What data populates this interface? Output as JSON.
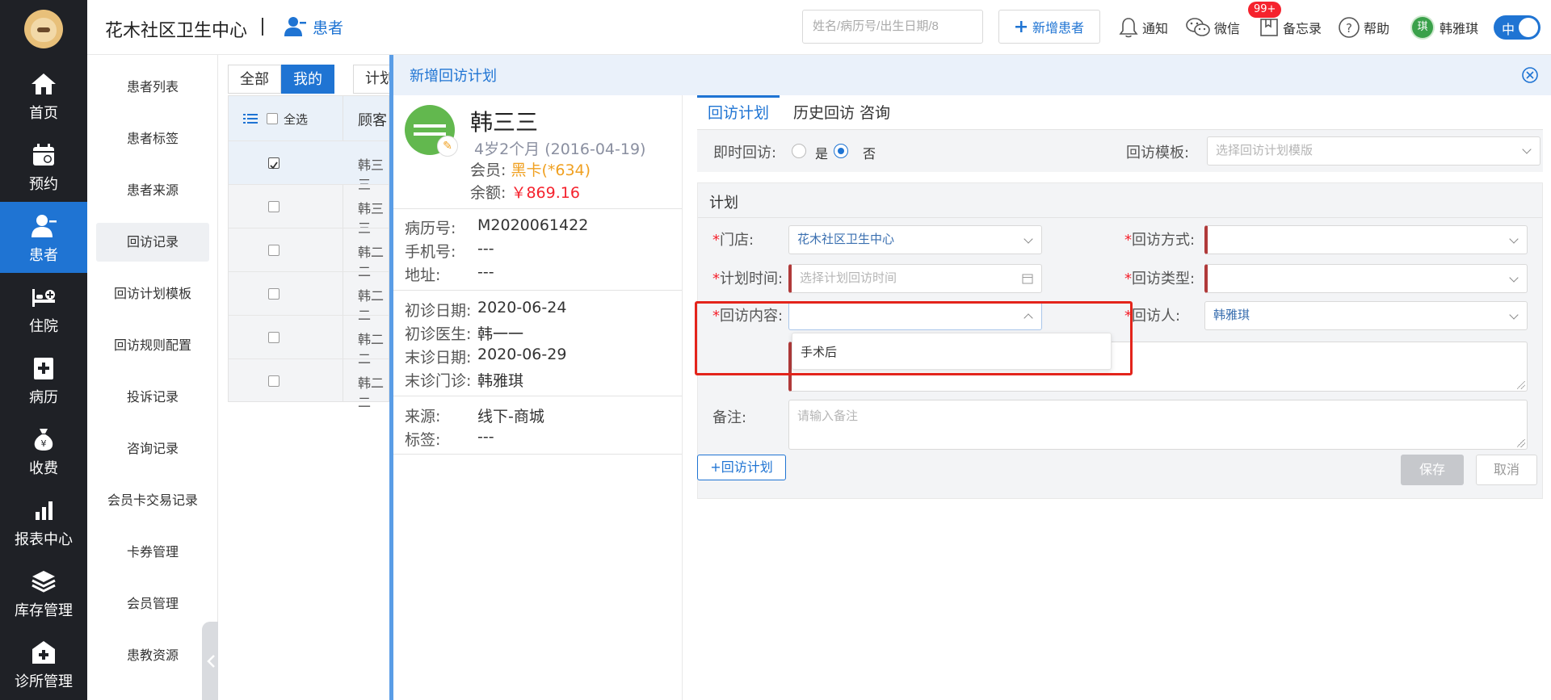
{
  "header": {
    "clinic_name": "花木社区卫生中心",
    "section_label": "患者",
    "search_placeholder": "姓名/病历号/出生日期/8",
    "new_patient_label": "新增患者",
    "notify_label": "通知",
    "notify_badge": "99+",
    "wechat_label": "微信",
    "memo_label": "备忘录",
    "help_label": "帮助",
    "user_avatar_text": "琪",
    "user_name": "韩雅琪",
    "toggle_label": "中"
  },
  "leftnav": {
    "items": [
      {
        "label": "首页",
        "icon": "home-icon"
      },
      {
        "label": "预约",
        "icon": "calendar-icon"
      },
      {
        "label": "患者",
        "icon": "patient-icon"
      },
      {
        "label": "住院",
        "icon": "hospital-bed-icon"
      },
      {
        "label": "病历",
        "icon": "medical-record-icon"
      },
      {
        "label": "收费",
        "icon": "money-bag-icon"
      },
      {
        "label": "报表中心",
        "icon": "bar-chart-icon"
      },
      {
        "label": "库存管理",
        "icon": "layers-icon"
      },
      {
        "label": "诊所管理",
        "icon": "clinic-icon"
      }
    ],
    "active_index": 2
  },
  "subnav": {
    "items": [
      "患者列表",
      "患者标签",
      "患者来源",
      "回访记录",
      "回访计划模板",
      "回访规则配置",
      "投诉记录",
      "咨询记录",
      "会员卡交易记录",
      "卡券管理",
      "会员管理",
      "患教资源"
    ],
    "active_index": 3
  },
  "background": {
    "tabs": [
      "全部",
      "我的"
    ],
    "plan_button": "计划",
    "select_all": "全选",
    "column_header": "顾客",
    "rows": [
      "韩三三",
      "韩三三",
      "韩二二",
      "韩二二",
      "韩二二",
      "韩二二"
    ]
  },
  "modal": {
    "title": "新增回访计划",
    "patient": {
      "name": "韩三三",
      "age": "4岁2个月 (2016-04-19)",
      "member_label": "会员:",
      "member_value": "黑卡(*634)",
      "balance_label": "余额:",
      "balance_value": "￥869.16",
      "record_no_label": "病历号:",
      "record_no": "M2020061422",
      "phone_label": "手机号:",
      "phone": "---",
      "address_label": "地址:",
      "address": "---",
      "first_visit_label": "初诊日期:",
      "first_visit": "2020-06-24",
      "first_doctor_label": "初诊医生:",
      "first_doctor": "韩一一",
      "last_visit_label": "末诊日期:",
      "last_visit": "2020-06-29",
      "last_clinic_label": "末诊门诊:",
      "last_clinic": "韩雅琪",
      "source_label": "来源:",
      "source": "线下-商城",
      "tags_label": "标签:",
      "tags": "---"
    },
    "tabs": [
      "回访计划",
      "历史回访",
      "咨询"
    ],
    "immediate_label": "即时回访:",
    "immediate_yes": "是",
    "immediate_no": "否",
    "immediate_value": "否",
    "template_label": "回访模板:",
    "template_placeholder": "选择回访计划模版",
    "plan_title": "计划",
    "store_label": "门店:",
    "store_value": "花木社区卫生中心",
    "method_label": "回访方式:",
    "time_label": "计划时间:",
    "time_placeholder": "选择计划回访时间",
    "type_label": "回访类型:",
    "content_label": "回访内容:",
    "content_options": [
      "手术后"
    ],
    "visitor_label": "回访人:",
    "visitor_value": "韩雅琪",
    "remark_label": "备注:",
    "remark_placeholder": "请输入备注",
    "add_plan_label": "+回访计划",
    "save_label": "保存",
    "cancel_label": "取消"
  },
  "colors": {
    "primary": "#1f74d3",
    "nav_bg": "#1f2126",
    "required": "#f5222d",
    "highlight_box": "#e3241b"
  }
}
